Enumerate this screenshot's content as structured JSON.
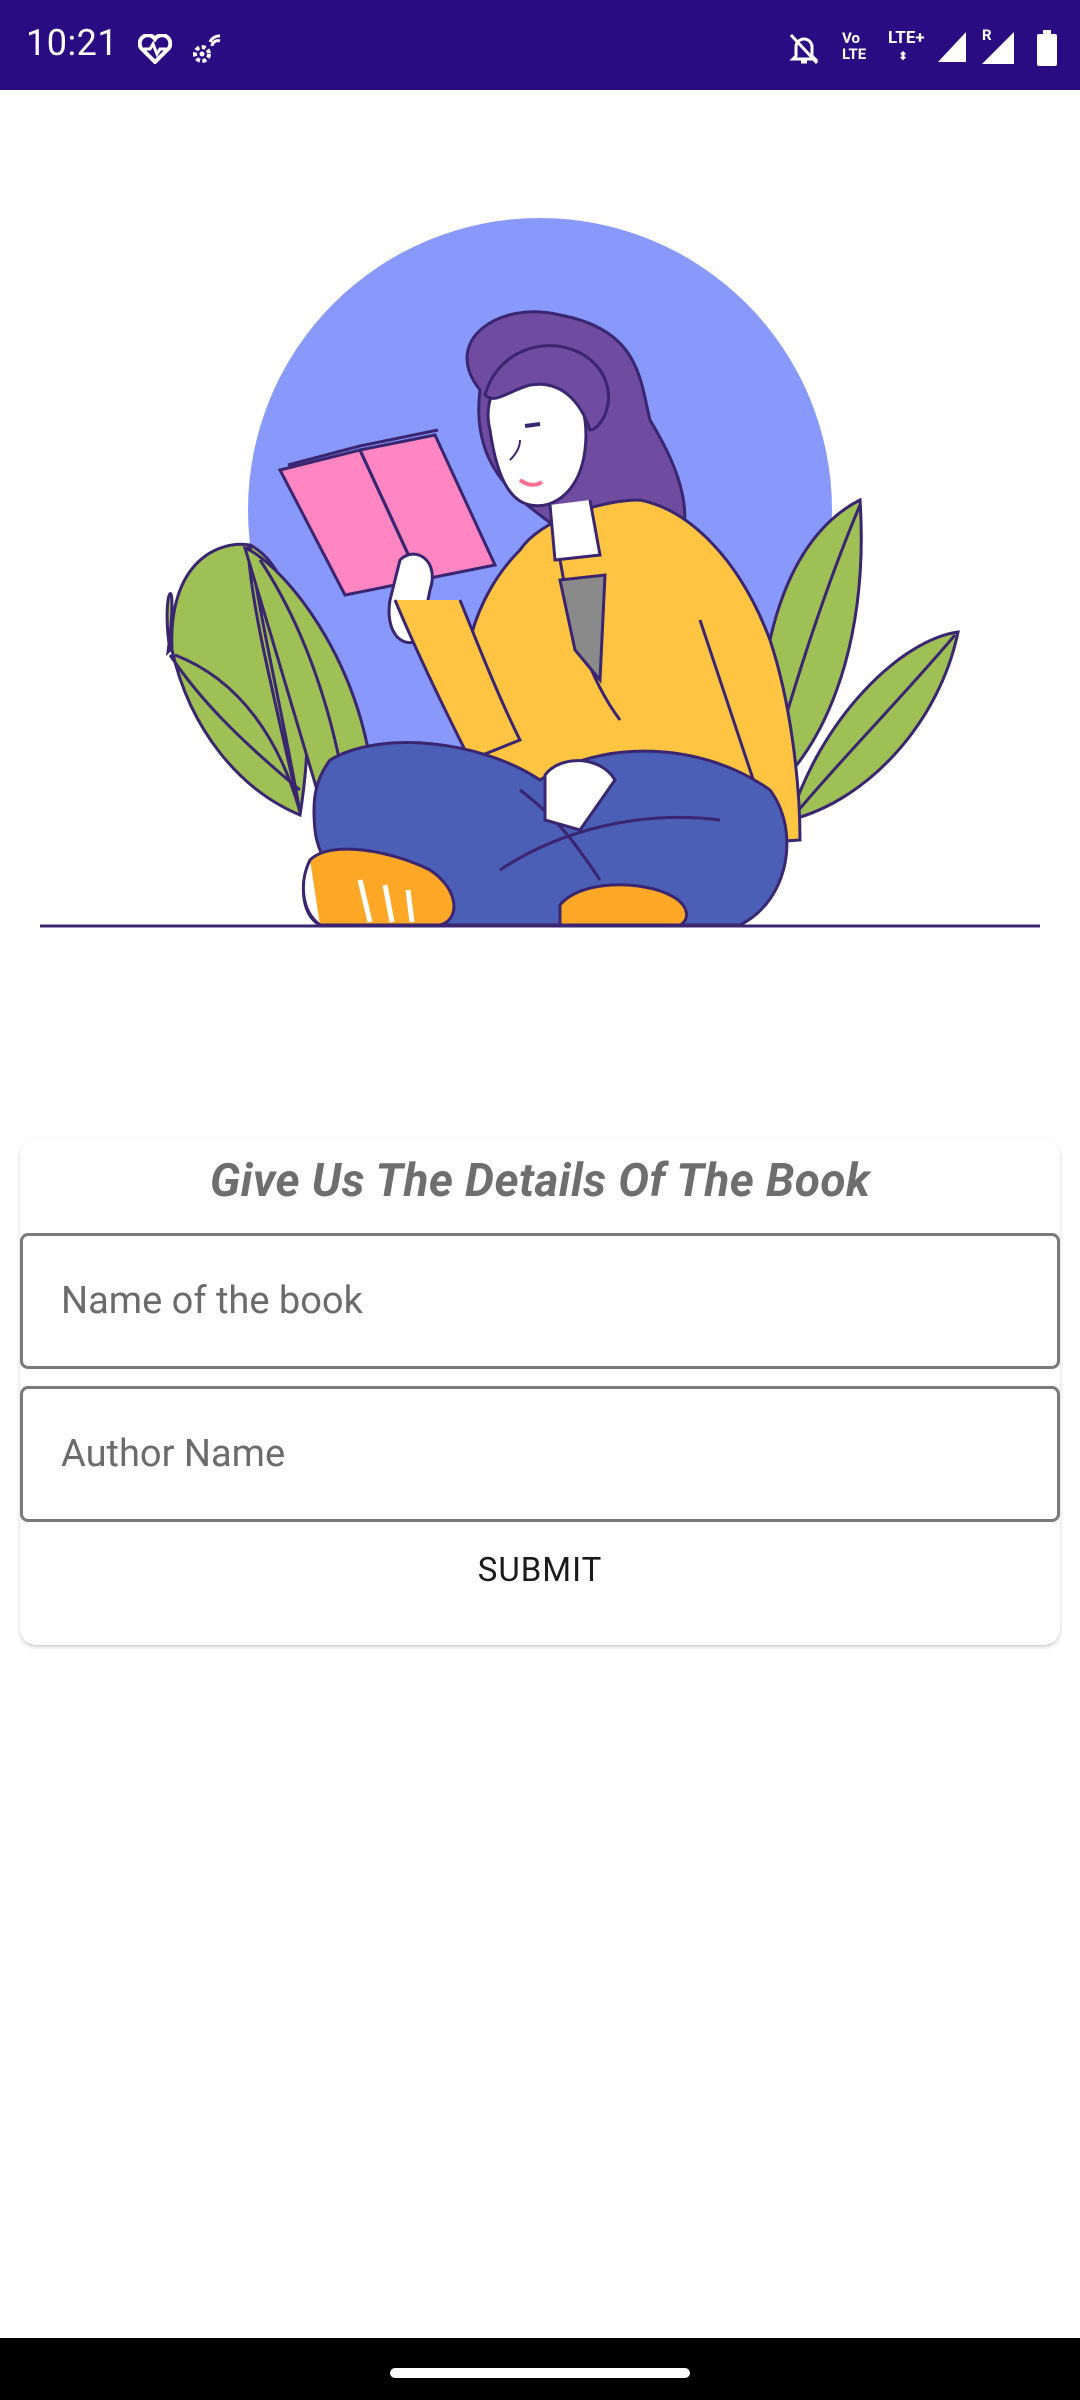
{
  "status_bar": {
    "time": "10:21",
    "lte_label": "LTE+",
    "volte_label": "Vo LTE",
    "roaming_label": "R",
    "icons": [
      "heart-monitor-icon",
      "wifi-settings-icon",
      "bell-off-icon",
      "volte-icon",
      "lte-plus-icon",
      "signal-icon",
      "signal-roaming-icon",
      "battery-icon"
    ]
  },
  "form": {
    "title": "Give Us The Details Of The Book",
    "book_name_placeholder": "Name of the book",
    "book_name_value": "",
    "author_placeholder": "Author Name",
    "author_value": "",
    "submit_label": "SUBMIT"
  },
  "colors": {
    "status_bar": "#2a0c82",
    "accent_circle": "#8899fb",
    "jacket": "#ffc542",
    "book": "#ff86c2",
    "leaves": "#9fc055",
    "outline": "#3a2670"
  }
}
